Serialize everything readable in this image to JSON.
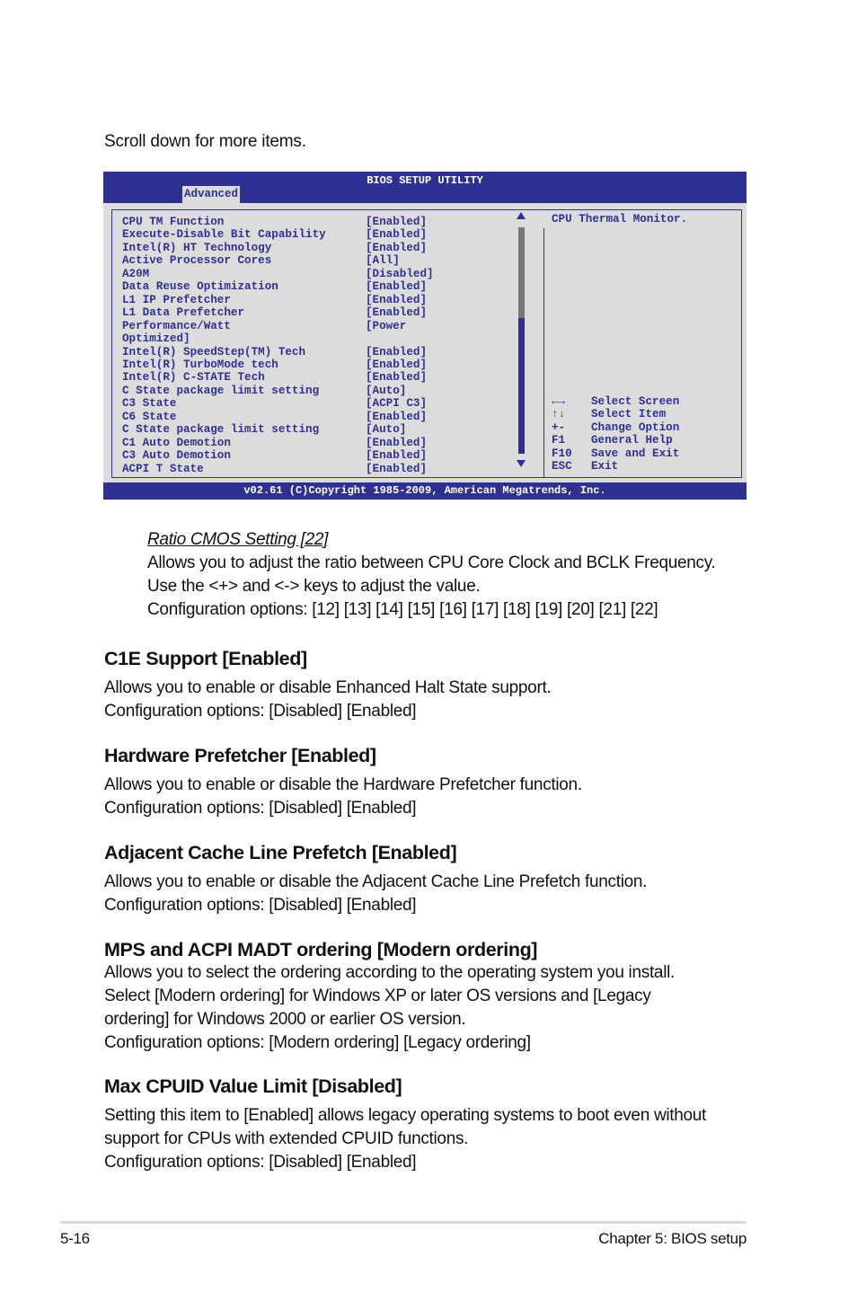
{
  "intro": "Scroll down for more items.",
  "bios": {
    "title": "BIOS SETUP UTILITY",
    "active_tab": "Advanced",
    "items": [
      {
        "label": "CPU TM Function",
        "value": "[Enabled]"
      },
      {
        "label": "Execute-Disable Bit Capability",
        "value": "[Enabled]"
      },
      {
        "label": "Intel(R) HT Technology",
        "value": "[Enabled]"
      },
      {
        "label": "Active Processor Cores",
        "value": "[All]"
      },
      {
        "label": "A20M",
        "value": "[Disabled]"
      },
      {
        "label": "Data Reuse Optimization",
        "value": "[Enabled]"
      },
      {
        "label": "L1 IP Prefetcher",
        "value": "[Enabled]"
      },
      {
        "label": "L1 Data Prefetcher",
        "value": "[Enabled]"
      },
      {
        "label": "Performance/Watt",
        "value": "[Power"
      },
      {
        "label": "Optimized]",
        "value": ""
      },
      {
        "label": "Intel(R) SpeedStep(TM) Tech",
        "value": "[Enabled]"
      },
      {
        "label": "Intel(R) TurboMode tech",
        "value": "[Enabled]"
      },
      {
        "label": "Intel(R) C-STATE Tech",
        "value": "[Enabled]"
      },
      {
        "label": "C State package limit setting",
        "value": "[Auto]"
      },
      {
        "label": "C3 State",
        "value": "[ACPI C3]"
      },
      {
        "label": "C6 State",
        "value": "[Enabled]"
      },
      {
        "label": "C State package limit setting",
        "value": "[Auto]"
      },
      {
        "label": "C1 Auto Demotion",
        "value": "[Enabled]"
      },
      {
        "label": "C3 Auto Demotion",
        "value": "[Enabled]"
      },
      {
        "label": "ACPI T State",
        "value": "[Enabled]"
      }
    ],
    "scroll_position_fraction": 0.6,
    "help_text": "CPU Thermal Monitor.",
    "keys": [
      {
        "key": "←→",
        "action": "Select Screen"
      },
      {
        "key": "↑↓",
        "action": "Select Item"
      },
      {
        "key": "+-",
        "action": "Change Option"
      },
      {
        "key": "F1",
        "action": "General Help"
      },
      {
        "key": "F10",
        "action": "Save and Exit"
      },
      {
        "key": "ESC",
        "action": "Exit"
      }
    ],
    "footer": "v02.61 (C)Copyright 1985-2009, American Megatrends, Inc.",
    "colors": {
      "primary": "#2e3192",
      "background": "#dcdcdc",
      "scroll_track": "#777777"
    }
  },
  "subsection": {
    "title": "Ratio CMOS Setting [22]",
    "lines": [
      "Allows you to adjust the ratio between CPU Core Clock and BCLK Frequency.",
      "Use the <+> and <-> keys to adjust the value.",
      "Configuration options: [12] [13] [14] [15] [16] [17] [18] [19] [20] [21] [22]"
    ]
  },
  "sections": [
    {
      "title": "C1E Support [Enabled]",
      "lines": [
        "Allows you to enable or disable Enhanced Halt State support.",
        "Configuration options: [Disabled] [Enabled]"
      ]
    },
    {
      "title": "Hardware Prefetcher [Enabled]",
      "lines": [
        "Allows you to enable or disable the Hardware Prefetcher function.",
        "Configuration options: [Disabled] [Enabled]"
      ]
    },
    {
      "title": "Adjacent Cache Line Prefetch [Enabled]",
      "lines": [
        "Allows you to enable or disable the Adjacent Cache Line Prefetch function.",
        "Configuration options: [Disabled] [Enabled]"
      ]
    },
    {
      "title": "MPS and ACPI MADT ordering [Modern ordering]",
      "lines": [
        "Allows you to select the ordering according to the operating system you install.",
        "Select [Modern ordering] for Windows XP or later OS versions and [Legacy",
        "ordering] for Windows 2000 or earlier OS version.",
        "Configuration options: [Modern ordering] [Legacy ordering]"
      ]
    },
    {
      "title": "Max CPUID Value Limit [Disabled]",
      "lines": [
        "Setting this item to [Enabled] allows legacy operating systems to boot even without",
        "support for CPUs with extended CPUID functions.",
        "Configuration options: [Disabled] [Enabled]"
      ]
    }
  ],
  "footer": {
    "page": "5-16",
    "chapter": "Chapter 5: BIOS setup"
  }
}
